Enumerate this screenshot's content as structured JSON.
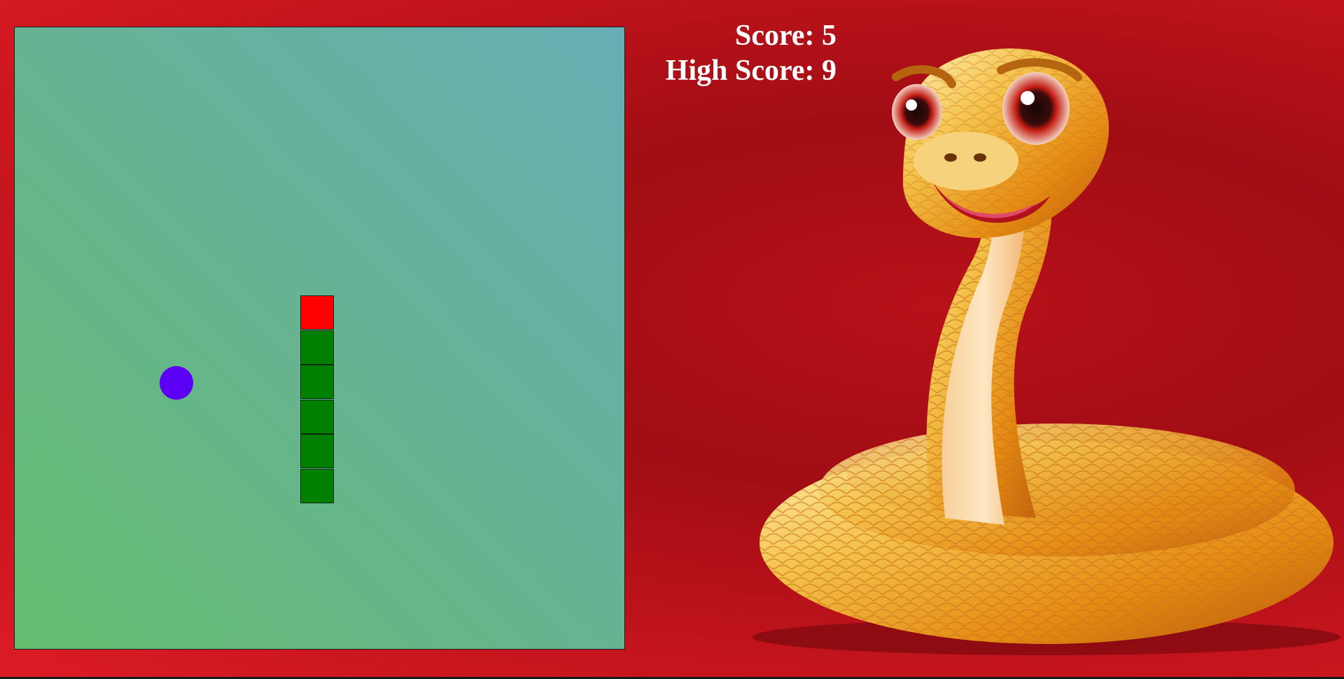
{
  "game": {
    "score_text": "Score: 5",
    "high_score_text": "High Score: 9",
    "score": 5,
    "high_score": 9
  },
  "board": {
    "grid_cell_units": 1,
    "snake": {
      "head_color": "#ff0000",
      "body_color": "#007f00",
      "segments": [
        {
          "col": 16,
          "row": 14
        },
        {
          "col": 16,
          "row": 15
        },
        {
          "col": 16,
          "row": 16
        },
        {
          "col": 16,
          "row": 17
        },
        {
          "col": 16,
          "row": 18
        },
        {
          "col": 16,
          "row": 19
        }
      ]
    },
    "food": {
      "col": 8,
      "row": 17,
      "color": "#5b00f5"
    }
  },
  "colors": {
    "background_red": "#c4141d",
    "score_text": "#ffffff"
  },
  "mascot": {
    "icon": "golden-snake-mascot"
  }
}
